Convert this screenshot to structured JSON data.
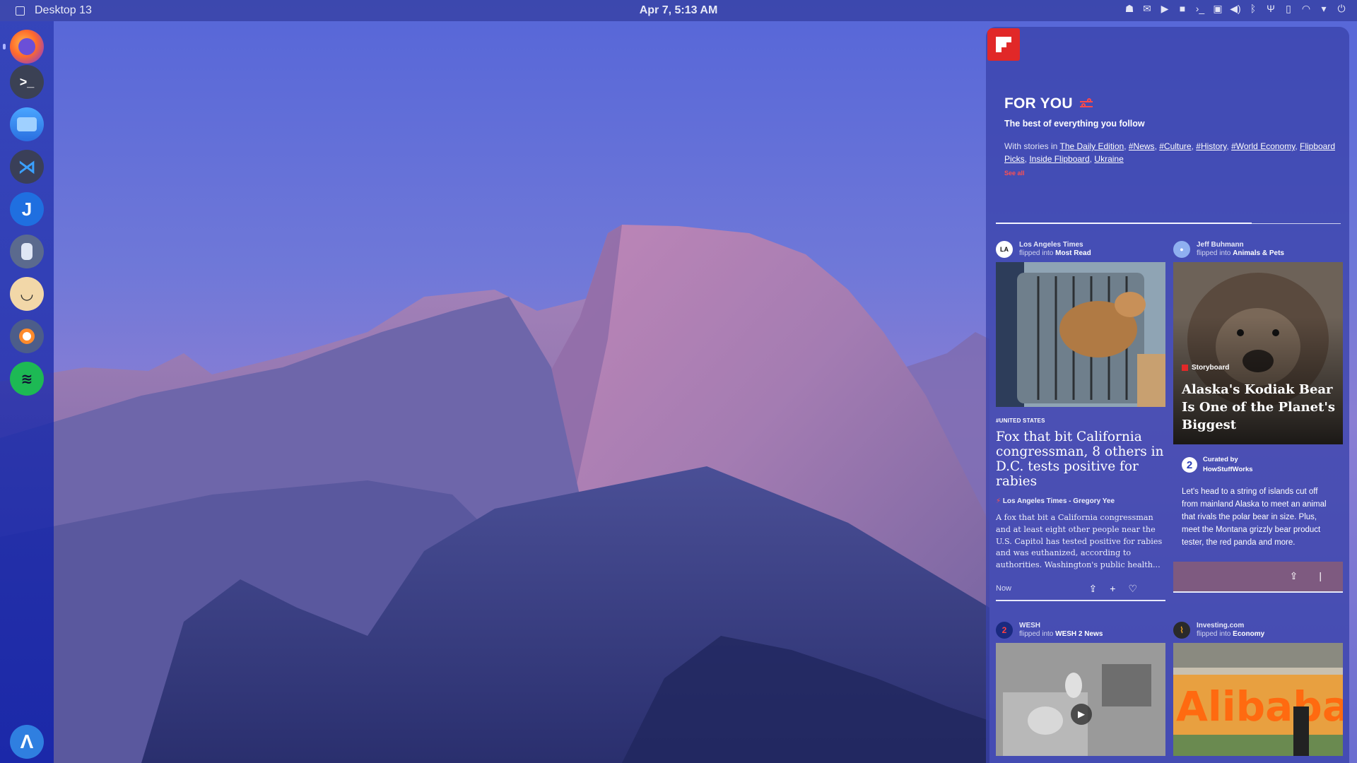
{
  "topbar": {
    "workspace": "Desktop 13",
    "clock": "Apr 7, 5:13 AM",
    "tray_icons": [
      "notification-icon",
      "mail-icon",
      "media-icon",
      "camera-icon",
      "terminal-icon",
      "screen-icon",
      "volume-icon",
      "bluetooth-icon",
      "usb-icon",
      "battery-icon",
      "wifi-icon",
      "dropdown-icon",
      "power-icon"
    ]
  },
  "dock": {
    "items": [
      "firefox",
      "terminal",
      "files",
      "vscode",
      "joplin",
      "figma",
      "inkscape",
      "blender",
      "spotify"
    ],
    "launcher": "app-launcher"
  },
  "feed": {
    "title": "FOR YOU",
    "tagline": "The best of everything you follow",
    "stories_prefix": "With stories in",
    "stories": [
      "The Daily Edition",
      "#News",
      "#Culture",
      "#History",
      "#World Economy",
      "Flipboard Picks",
      "Inside Flipboard",
      "Ukraine"
    ],
    "see_all": "See all",
    "cards": [
      {
        "source": "Los Angeles Times",
        "flipped_prefix": "flipped into",
        "flipped_into": "Most Read",
        "avatar": "LA",
        "tag": "#UNITED STATES",
        "title": "Fox that bit California congressman, 8 others in D.C. tests positive for rabies",
        "byline": "Los Angeles Times - Gregory Yee",
        "excerpt": "A fox that bit a California congressman and at least eight other people near the U.S. Capitol has tested positive for rabies and was euthanized, according to authorities. Washington's public health...",
        "time": "Now"
      },
      {
        "source": "Jeff Buhmann",
        "flipped_prefix": "flipped into",
        "flipped_into": "Animals & Pets",
        "label": "Storyboard",
        "title": "Alaska's Kodiak Bear Is One of the Planet's Biggest",
        "curated_label": "Curated by",
        "curated_by": "HowStuffWorks",
        "curated_avatar": "2",
        "description": "Let's head to a string of islands cut off from mainland Alaska to meet an animal that rivals the polar bear in size. Plus, meet the Montana grizzly bear product tester, the red panda and more."
      },
      {
        "source": "WESH",
        "flipped_prefix": "flipped into",
        "flipped_into": "WESH 2 News",
        "avatar": "2"
      },
      {
        "source": "Investing.com",
        "flipped_prefix": "flipped into",
        "flipped_into": "Economy",
        "sign_text": "Alibaba"
      }
    ]
  },
  "colors": {
    "accent": "#e12828",
    "panel": "#3a42aa",
    "sky_top": "#5866d6",
    "sky_bottom": "#8a7fd6"
  }
}
